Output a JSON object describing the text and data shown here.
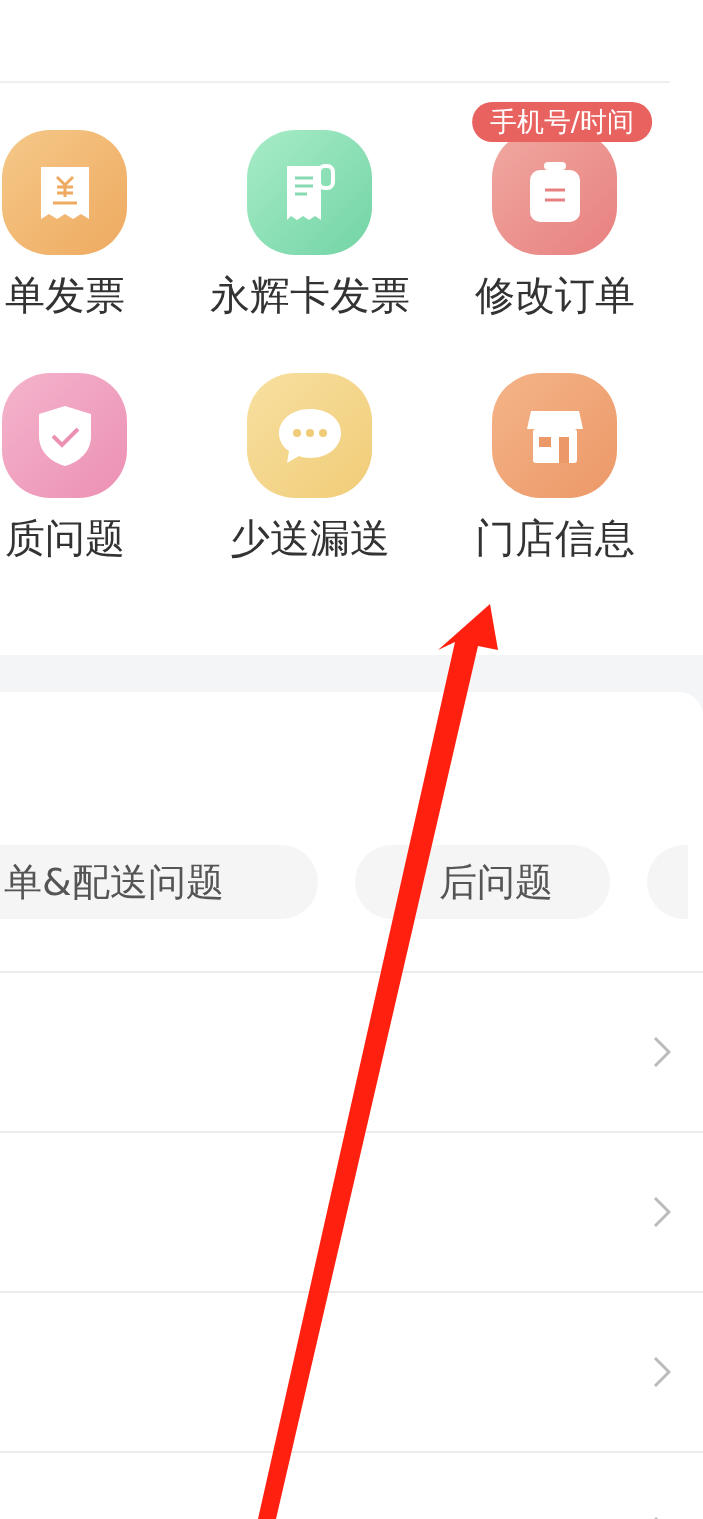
{
  "services": [
    {
      "label": "单发票",
      "kind": "invoice"
    },
    {
      "label": "永辉卡发票",
      "kind": "card-invoice"
    },
    {
      "label": "修改订单",
      "kind": "edit-order",
      "badge": "手机号/时间"
    },
    {
      "label": "质问题",
      "kind": "quality"
    },
    {
      "label": "少送漏送",
      "kind": "missing"
    },
    {
      "label": "门店信息",
      "kind": "store"
    }
  ],
  "chips": [
    {
      "kind": "text",
      "label": "单&配送问题"
    },
    {
      "kind": "text",
      "label": "后问题"
    },
    {
      "kind": "cut"
    }
  ],
  "list_rows": [
    {
      "kind": "link"
    },
    {
      "kind": "link"
    },
    {
      "kind": "link"
    },
    {
      "kind": "link"
    }
  ]
}
